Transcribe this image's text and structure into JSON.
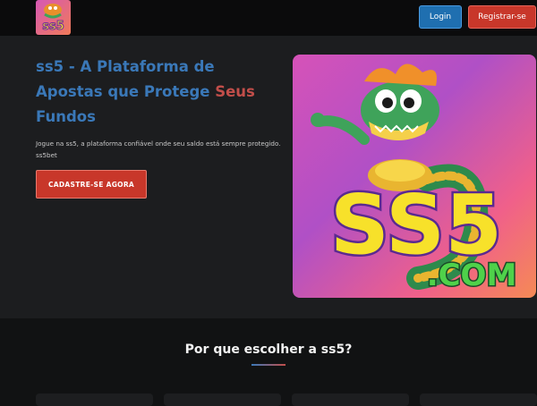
{
  "header": {
    "logo_text": "ss5",
    "login_label": "Login",
    "register_label": "Registrar-se"
  },
  "hero": {
    "title_part1": "ss5 - A Plataforma de Apostas que Protege ",
    "title_accent": "Seus",
    "title_part2": " Fundos",
    "description": "Jogue na ss5, a plataforma confiável onde seu saldo está sempre protegido. ss5bet",
    "cta_label": "CADASTRE-SE AGORA",
    "image_text_main": "SS5",
    "image_text_domain": ".COM"
  },
  "features": {
    "title": "Por que escolher a ss5?"
  },
  "colors": {
    "primary_blue": "#1f6fb0",
    "primary_red": "#c8372a",
    "title_blue": "#3a78b8",
    "title_red": "#c24e4a"
  }
}
